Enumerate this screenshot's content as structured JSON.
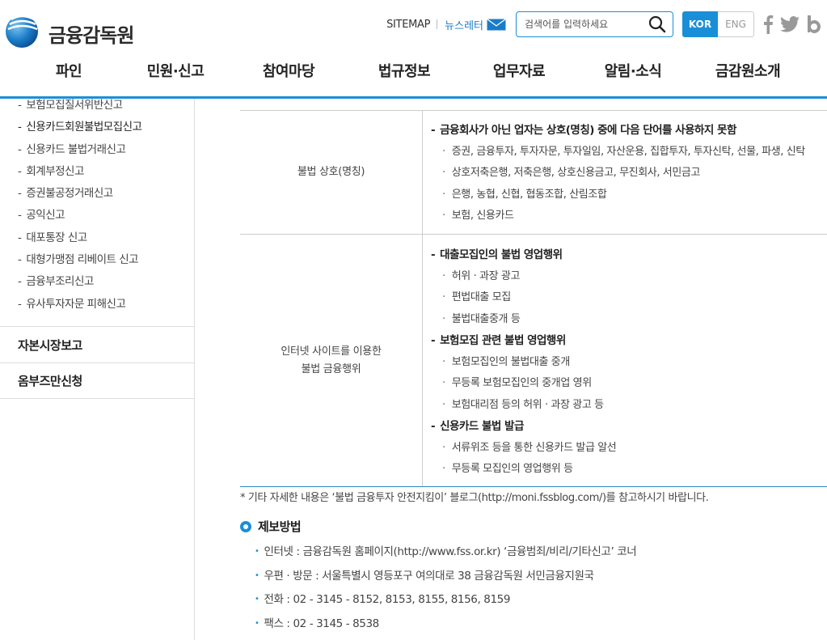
{
  "header": {
    "logo_text": "금융감독원",
    "sitemap": "SITEMAP",
    "newsletter": "뉴스레터",
    "search_placeholder": "검색어를 입력하세요",
    "lang_kor": "KOR",
    "lang_eng": "ENG",
    "sns": [
      "facebook-icon",
      "twitter-icon",
      "blog-icon"
    ],
    "accent_color": "#1a8fd8"
  },
  "gnb": [
    "파인",
    "민원·신고",
    "참여마당",
    "법규정보",
    "업무자료",
    "알림·소식",
    "금감원소개"
  ],
  "sidebar": {
    "sub_items": [
      "보험모집질서위반신고",
      "신용카드회원불법모집신고",
      "신용카드 불법거래신고",
      "회계부정신고",
      "증권불공정거래신고",
      "공익신고",
      "대포통장 신고",
      "대형가맹점 리베이트 신고",
      "금융부조리신고",
      "유사투자자문 피해신고"
    ],
    "menu": [
      "자본시장보고",
      "옴부즈만신청"
    ]
  },
  "table": {
    "rows": [
      {
        "label": "불법 상호(명칭)",
        "groups": [
          {
            "head": "금융회사가 아닌 업자는 상호(명칭) 중에 다음 단어를 사용하지 못함",
            "items": [
              "증권, 금융투자, 투자자문, 투자일임, 자산운용, 집합투자, 투자신탁, 선물, 파생, 신탁",
              "상호저축은행, 저축은행, 상호신용금고, 무진회사, 서민금고",
              "은행, 농협, 신협, 협동조합, 산림조합",
              "보험, 신용카드"
            ]
          }
        ]
      },
      {
        "label_line1": "인터넷 사이트를 이용한",
        "label_line2": "불법 금융행위",
        "groups": [
          {
            "head": "대출모집인의 불법 영업행위",
            "items": [
              "허위 · 과장 광고",
              "편법대출 모집",
              "불법대출중개 등"
            ]
          },
          {
            "head": "보험모집 관련 불법 영업행위",
            "items": [
              "보험모집인의 불법대출 중개",
              "무등록 보험모집인의 중개업 영위",
              "보험대리점 등의 허위 · 과장 광고 등"
            ]
          },
          {
            "head": "신용카드 불법 발급",
            "items": [
              "서류위조 등을 통한 신용카드 발급 알선",
              "무등록 모집인의 영업행위 등"
            ]
          }
        ]
      }
    ]
  },
  "note": "* 기타 자세한 내용은 ‘불법 금융투자 안전지킴이’ 블로그(http://moni.fssblog.com/)를 참고하시기 바랍니다.",
  "report": {
    "title": "제보방법",
    "items": [
      "인터넷 : 금융감독원 홈페이지(http://www.fss.or.kr) ‘금융범죄/비리/기타신고’ 코너",
      "우편 · 방문 : 서울특별시 영등포구 여의대로 38 금융감독원 서민금융지원국",
      "전화 : 02 - 3145 - 8152, 8153, 8155, 8156, 8159",
      "팩스 : 02 - 3145 - 8538"
    ]
  }
}
